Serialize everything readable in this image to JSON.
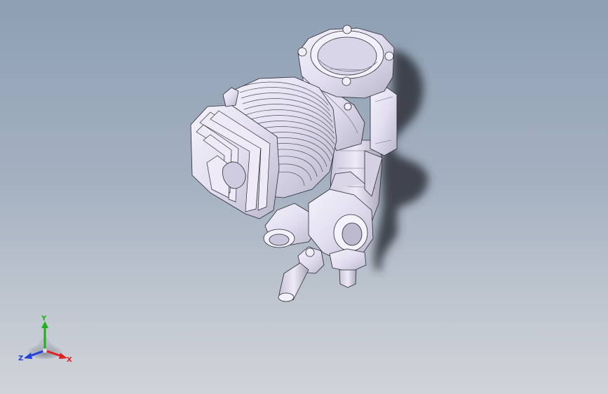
{
  "triad": {
    "x_label": "X",
    "y_label": "Y",
    "z_label": "Z",
    "x_color": "#e02020",
    "y_color": "#20b020",
    "z_color": "#2040e0"
  },
  "model": {
    "icon": "engine-model"
  },
  "colors": {
    "background_top": "#8e9fb3",
    "background_bottom": "#d0d3d9",
    "part_fill": "#e6e2f3",
    "part_edge": "#2a2a35"
  }
}
